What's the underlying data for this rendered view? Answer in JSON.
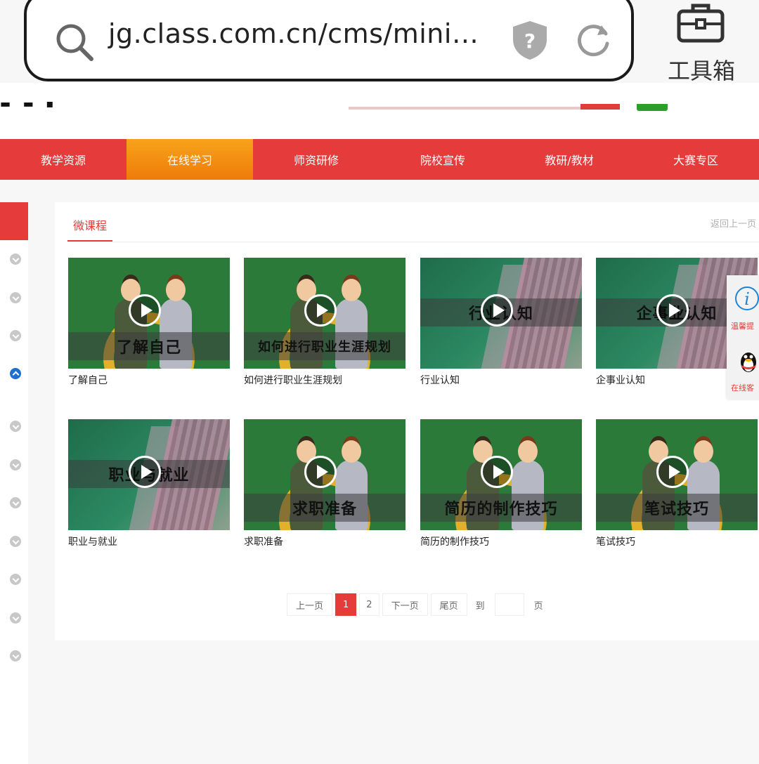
{
  "browser": {
    "url": "jg.class.com.cn/cms/mini…",
    "toolbox_label": "工具箱"
  },
  "nav": {
    "items": [
      {
        "label": "教学资源"
      },
      {
        "label": "在线学习"
      },
      {
        "label": "师资研修"
      },
      {
        "label": "院校宣传"
      },
      {
        "label": "教研/教材"
      },
      {
        "label": "大赛专区"
      }
    ],
    "active_index": 1
  },
  "panel": {
    "tab_title": "微课程",
    "back_link": "返回上一页"
  },
  "courses": [
    {
      "title": "了解自己",
      "thumb_text": "了解自己",
      "style": "people"
    },
    {
      "title": "如何进行职业生涯规划",
      "thumb_text": "如何进行职业生涯规划",
      "style": "people"
    },
    {
      "title": "行业认知",
      "thumb_text": "行业认知",
      "style": "city"
    },
    {
      "title": "企事业认知",
      "thumb_text": "企事业认知",
      "style": "city"
    },
    {
      "title": "职业与就业",
      "thumb_text": "职业与就业",
      "style": "city"
    },
    {
      "title": "求职准备",
      "thumb_text": "求职准备",
      "style": "people"
    },
    {
      "title": "简历的制作技巧",
      "thumb_text": "简历的制作技巧",
      "style": "people"
    },
    {
      "title": "笔试技巧",
      "thumb_text": "笔试技巧",
      "style": "people"
    }
  ],
  "pagination": {
    "prev": "上一页",
    "pages": [
      "1",
      "2"
    ],
    "current": "1",
    "next": "下一页",
    "last": "尾页",
    "goto": "到",
    "page_unit": "页"
  },
  "float": {
    "tip_label": "温馨提",
    "service_label": "在线客"
  },
  "colors": {
    "brand_red": "#e63b3b",
    "active_orange": "#f39416",
    "link_blue": "#1c6fd1"
  }
}
